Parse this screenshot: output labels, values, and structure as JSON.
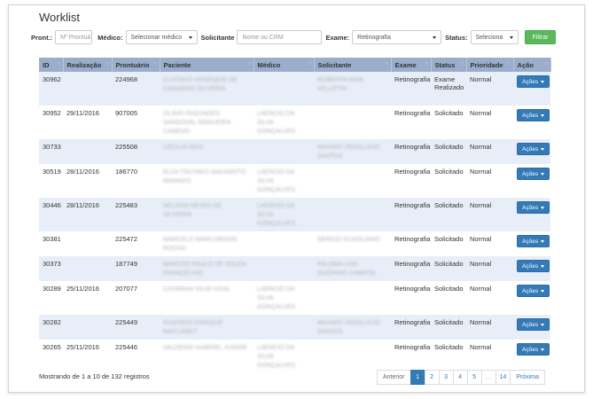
{
  "page": {
    "title": "Worklist"
  },
  "filters": {
    "pront_label": "Pront.:",
    "pront_placeholder": "Nº Prontuá",
    "medico_label": "Médico:",
    "medico_value": "Selecionar médico",
    "solicitante_label": "Solicitante",
    "solicitante_placeholder": "Nome ou CRM",
    "exame_label": "Exame:",
    "exame_value": "Retinografia",
    "status_label": "Status:",
    "status_value": "Seleciona",
    "filter_button": "Filtrar"
  },
  "table": {
    "headers": [
      "ID",
      "Realização",
      "Prontuário",
      "Paciente",
      "Médico",
      "Solicitante",
      "Exame",
      "Status",
      "Prioridade",
      "Ação"
    ],
    "rows": [
      {
        "id": "30962",
        "realizacao": "",
        "prontuario": "224968",
        "paciente": "GUSTAVO HENRIQUE DE CAMARGO OLIVEIRA",
        "medico": "",
        "solicitante": "ROBERTA MAIA VELLETRI",
        "exame": "Retinografia",
        "status": "Exame Realizado",
        "prioridade": "Normal",
        "acao": "Ações"
      },
      {
        "id": "30952",
        "realizacao": "29/11/2016",
        "prontuario": "907005",
        "paciente": "OLAVO FAGUNDES SANDOVAL NOGUEIRA CANEDO",
        "medico": "LAERCIO DA SILVA GONÇALVES",
        "solicitante": "",
        "exame": "Retinografia",
        "status": "Solicitado",
        "prioridade": "Normal",
        "acao": "Ações"
      },
      {
        "id": "30733",
        "realizacao": "",
        "prontuario": "225508",
        "paciente": "CECILIA REIS",
        "medico": "",
        "solicitante": "MAXIMO VERALUCIO SANTOS",
        "exame": "Retinografia",
        "status": "Solicitado",
        "prioridade": "Normal",
        "acao": "Ações"
      },
      {
        "id": "30519",
        "realizacao": "28/11/2016",
        "prontuario": "186770",
        "paciente": "ELZA TSUYAKO NAKAMOTO MAMADO",
        "medico": "LAERCIO DA SILVA GONÇALVES",
        "solicitante": "",
        "exame": "Retinografia",
        "status": "Solicitado",
        "prioridade": "Normal",
        "acao": "Ações"
      },
      {
        "id": "30446",
        "realizacao": "28/11/2016",
        "prontuario": "225483",
        "paciente": "NELSON NEVES DE OLIVEIRA",
        "medico": "LAERCIO DA SILVA GONÇALVES",
        "solicitante": "",
        "exame": "Retinografia",
        "status": "Solicitado",
        "prioridade": "Normal",
        "acao": "Ações"
      },
      {
        "id": "30381",
        "realizacao": "",
        "prontuario": "225472",
        "paciente": "MARCELO MARCORDON ROCHA",
        "medico": "",
        "solicitante": "SERGIO GUAGLIANO",
        "exame": "Retinografia",
        "status": "Solicitado",
        "prioridade": "Normal",
        "acao": "Ações"
      },
      {
        "id": "30373",
        "realizacao": "",
        "prontuario": "187749",
        "paciente": "MARCOS PAULO DE SOUZA FRANCELINO",
        "medico": "",
        "solicitante": "PALOMA LINS GODINHO CAMPOS",
        "exame": "Retinografia",
        "status": "Solicitado",
        "prioridade": "Normal",
        "acao": "Ações"
      },
      {
        "id": "30289",
        "realizacao": "25/11/2016",
        "prontuario": "207077",
        "paciente": "CATARINA SILVA VIDAL",
        "medico": "LAERCIO DA SILVA GONÇALVES",
        "solicitante": "",
        "exame": "Retinografia",
        "status": "Solicitado",
        "prioridade": "Normal",
        "acao": "Ações"
      },
      {
        "id": "30282",
        "realizacao": "",
        "prontuario": "225449",
        "paciente": "GUSTAVO ENRIQUE MACLANDT",
        "medico": "",
        "solicitante": "MAXIMO VERALUCIO SANTOS",
        "exame": "Retinografia",
        "status": "Solicitado",
        "prioridade": "Normal",
        "acao": "Ações"
      },
      {
        "id": "30265",
        "realizacao": "25/11/2016",
        "prontuario": "225446",
        "paciente": "VALDENIR GABRIEL JUNIOR",
        "medico": "LAERCIO DA SILVA GONÇALVES",
        "solicitante": "",
        "exame": "Retinografia",
        "status": "Solicitado",
        "prioridade": "Normal",
        "acao": "Ações"
      }
    ]
  },
  "footer": {
    "info": "Mostrando de 1 a 10 de 132 registros",
    "pagination": {
      "previous": "Anterior",
      "pages": [
        "1",
        "2",
        "3",
        "4",
        "5",
        "…",
        "14"
      ],
      "next": "Próxima",
      "active": "1"
    }
  },
  "colors": {
    "header_bg": "#9aaecb",
    "row_alt": "#e8eef7",
    "primary": "#337ab7",
    "success": "#5cb85c"
  }
}
